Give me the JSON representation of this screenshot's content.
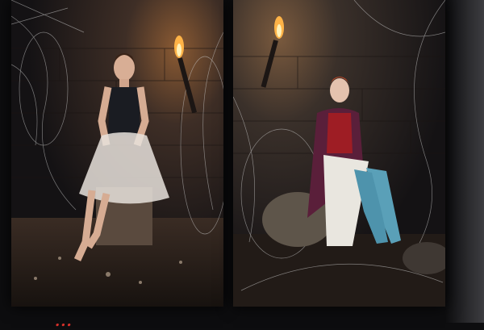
{
  "caption": {
    "text": "...",
    "color": "#d8302a"
  },
  "photos": [
    {
      "id": "left",
      "subject": "girl-seated-on-brick-block",
      "torch": "lit"
    },
    {
      "id": "right",
      "subject": "girl-seated-on-rock",
      "torch": "lit"
    }
  ],
  "colors": {
    "background": "#0d0d0f",
    "stone_dark": "#2a2320",
    "flame": "#ffb347",
    "cobweb": "#d8d8d8"
  }
}
